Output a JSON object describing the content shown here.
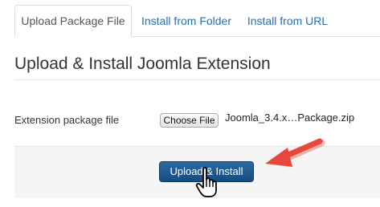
{
  "tabs": [
    {
      "label": "Upload Package File",
      "active": true
    },
    {
      "label": "Install from Folder",
      "active": false
    },
    {
      "label": "Install from URL",
      "active": false
    }
  ],
  "section": {
    "title": "Upload & Install Joomla Extension"
  },
  "form": {
    "field_label": "Extension package file",
    "choose_button": "Choose File",
    "file_name": "Joomla_3.4.x…Package.zip",
    "submit_button": "Upload & Install"
  },
  "annotations": {
    "arrow_color": "#e8473b",
    "pointer_icon": "hand-pointer-icon",
    "arrow_icon": "arrow-left-icon"
  },
  "colors": {
    "link": "#2a6db0",
    "primary_button": "#1f5a91",
    "actions_background": "#f5f5f5"
  }
}
